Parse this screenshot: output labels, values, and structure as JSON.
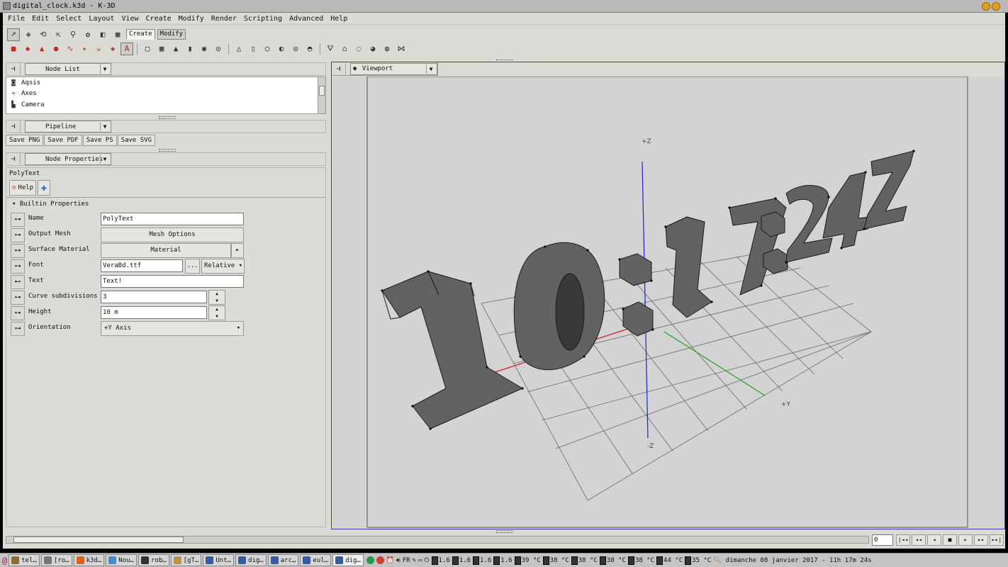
{
  "window": {
    "title": "digital_clock.k3d - K-3D"
  },
  "menu": [
    "File",
    "Edit",
    "Select",
    "Layout",
    "View",
    "Create",
    "Modify",
    "Render",
    "Scripting",
    "Advanced",
    "Help"
  ],
  "toolbar_tabs": {
    "create": "Create",
    "modify": "Modify"
  },
  "panels": {
    "node_list": {
      "combo": "Node List",
      "items": [
        {
          "label": "Aqsis",
          "icon": "aqsis-icon"
        },
        {
          "label": "Axes",
          "icon": "axes-icon"
        },
        {
          "label": "Camera",
          "icon": "camera-icon"
        }
      ]
    },
    "pipeline": {
      "combo": "Pipeline",
      "buttons": [
        "Save PNG",
        "Save PDF",
        "Save PS",
        "Save SVG"
      ]
    },
    "node_properties": {
      "combo": "Node Properties",
      "node_name": "PolyText",
      "help_label": "Help",
      "section": "Builtin Properties",
      "props": {
        "name": {
          "label": "Name",
          "value": "PolyText"
        },
        "output_mesh": {
          "label": "Output Mesh",
          "value": "Mesh Options"
        },
        "surface_material": {
          "label": "Surface Material",
          "value": "Material"
        },
        "font": {
          "label": "Font",
          "value": "VeraBd.ttf",
          "dots": "...",
          "mode": "Relative"
        },
        "text": {
          "label": "Text",
          "value": "Text!"
        },
        "curve_subdivisions": {
          "label": "Curve subdivisions",
          "value": "3"
        },
        "height": {
          "label": "Height",
          "value": "10 m"
        },
        "orientation": {
          "label": "Orientation",
          "value": "+Y Axis"
        }
      }
    }
  },
  "viewport": {
    "combo": "Viewport",
    "axis_labels": {
      "pz": "+Z",
      "nz": "-Z",
      "py": "+Y"
    },
    "text_3d": "10:17:24Z",
    "colors": {
      "background": "#d3d3d3",
      "glyph_face": "#626262",
      "z_axis": "#2020d0",
      "x_axis": "#d02020",
      "y_axis": "#20a020"
    }
  },
  "timeline": {
    "frame": "0",
    "transport": [
      "|◂◂",
      "◂◂",
      "◂",
      "■",
      "▸",
      "▸▸",
      "▸▸|"
    ]
  },
  "taskbar": {
    "tasks": [
      {
        "label": "tel…",
        "color": "#8a6a3a"
      },
      {
        "label": "[ro…",
        "color": "#777"
      },
      {
        "label": "k3d…",
        "color": "#e06020"
      },
      {
        "label": "Nou…",
        "color": "#4a8ad0"
      },
      {
        "label": "rob…",
        "color": "#333"
      },
      {
        "label": "[gT…",
        "color": "#c09040"
      },
      {
        "label": "Unt…",
        "color": "#3a5aa0"
      },
      {
        "label": "dig…",
        "color": "#3a5aa0"
      },
      {
        "label": "arc…",
        "color": "#3a5aa0"
      },
      {
        "label": "eul…",
        "color": "#3a5aa0"
      },
      {
        "label": "dig…",
        "color": "#3a5aa0",
        "active": true
      }
    ],
    "lang": "FR",
    "freqs": [
      "1.6",
      "1.6",
      "1.6",
      "1.6"
    ],
    "temps": [
      "39 °C",
      "38 °C",
      "38 °C",
      "38 °C",
      "38 °C",
      "44 °C",
      "35 °C"
    ],
    "clock": "dimanche 08 janvier 2017 - 11h 17m 24s"
  }
}
